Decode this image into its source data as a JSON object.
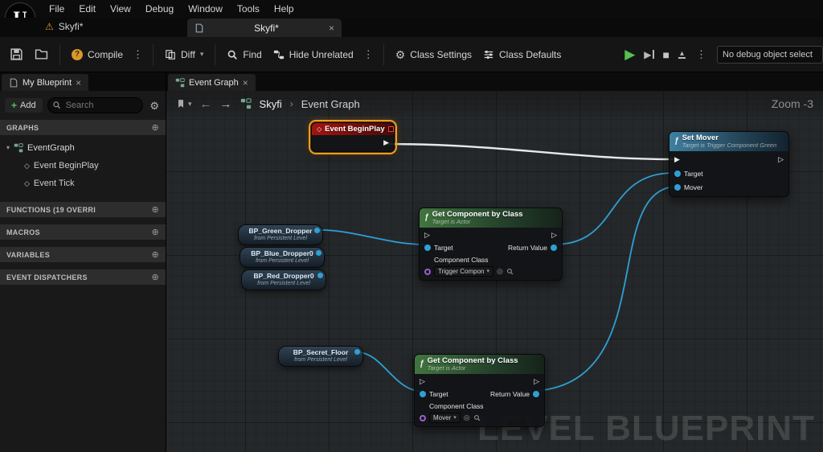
{
  "icons": {
    "kebab": "⋮",
    "dropdown": "▾",
    "close": "×",
    "plus": "+",
    "gear": "⚙",
    "warning": "⚠",
    "back": "←",
    "forward": "→",
    "sep": "›",
    "expand": "▾",
    "diamond_hollow": "◇",
    "circle_plus": "⊕",
    "play": "▶",
    "stop": "■",
    "eject": "▴",
    "exec_filled": "▶",
    "exec_hollow": "▷",
    "fx": "ƒ",
    "circle": "◎",
    "question": "?",
    "logo": "U"
  },
  "menubar": {
    "items": [
      "File",
      "Edit",
      "View",
      "Debug",
      "Window",
      "Tools",
      "Help"
    ]
  },
  "asset_bar": {
    "shortcut_label": "Skyfi*",
    "tab_label": "Skyfi*"
  },
  "toolbar": {
    "compile": "Compile",
    "diff": "Diff",
    "find": "Find",
    "hide_unrelated": "Hide Unrelated",
    "class_settings": "Class Settings",
    "class_defaults": "Class Defaults",
    "debug_object": "No debug object select"
  },
  "my_blueprint": {
    "tab": "My Blueprint",
    "add": "Add",
    "search_placeholder": "Search",
    "sections": {
      "graphs": "GRAPHS",
      "functions": "FUNCTIONS (19 OVERRI",
      "macros": "MACROS",
      "variables": "VARIABLES",
      "dispatchers": "EVENT DISPATCHERS"
    },
    "tree": {
      "event_graph": "EventGraph",
      "event_beginplay": "Event BeginPlay",
      "event_tick": "Event Tick"
    }
  },
  "graph": {
    "tab": "Event Graph",
    "breadcrumb": {
      "root": "Skyfi",
      "current": "Event Graph"
    },
    "zoom": "Zoom -3",
    "watermark": "LEVEL BLUEPRINT",
    "colors": {
      "event_header": "#9e1410",
      "function_header": "#3e6e3f",
      "target_header": "#3f7fa0",
      "selection": "#f09c1c",
      "exec_wire": "#e8e8e8",
      "data_wire": "#2f9fd6",
      "object_pin": "#2f9fd6",
      "class_pin": "#9b5fd0"
    },
    "nodes": {
      "event_beginplay": {
        "title": "Event BeginPlay"
      },
      "set_mover": {
        "title": "Set Mover",
        "subtitle": "Target is Trigger Component Green",
        "pin_target": "Target",
        "pin_mover": "Mover"
      },
      "get_component_1": {
        "title": "Get Component by Class",
        "subtitle": "Target is Actor",
        "pin_target": "Target",
        "pin_return": "Return Value",
        "pin_class": "Component Class",
        "class_value": "Trigger Compon"
      },
      "get_component_2": {
        "title": "Get Component by Class",
        "subtitle": "Target is Actor",
        "pin_target": "Target",
        "pin_return": "Return Value",
        "pin_class": "Component Class",
        "class_value": "Mover"
      },
      "bp_green_dropper": {
        "title": "BP_Green_Dropper",
        "subtitle": "from Persistent Level"
      },
      "bp_blue_dropper": {
        "title": "BP_Blue_Dropper0",
        "subtitle": "from Persistent Level"
      },
      "bp_red_dropper": {
        "title": "BP_Red_Dropper0",
        "subtitle": "from Persistent Level"
      },
      "bp_secret_floor": {
        "title": "BP_Secret_Floor",
        "subtitle": "from Persistent Level"
      }
    }
  }
}
